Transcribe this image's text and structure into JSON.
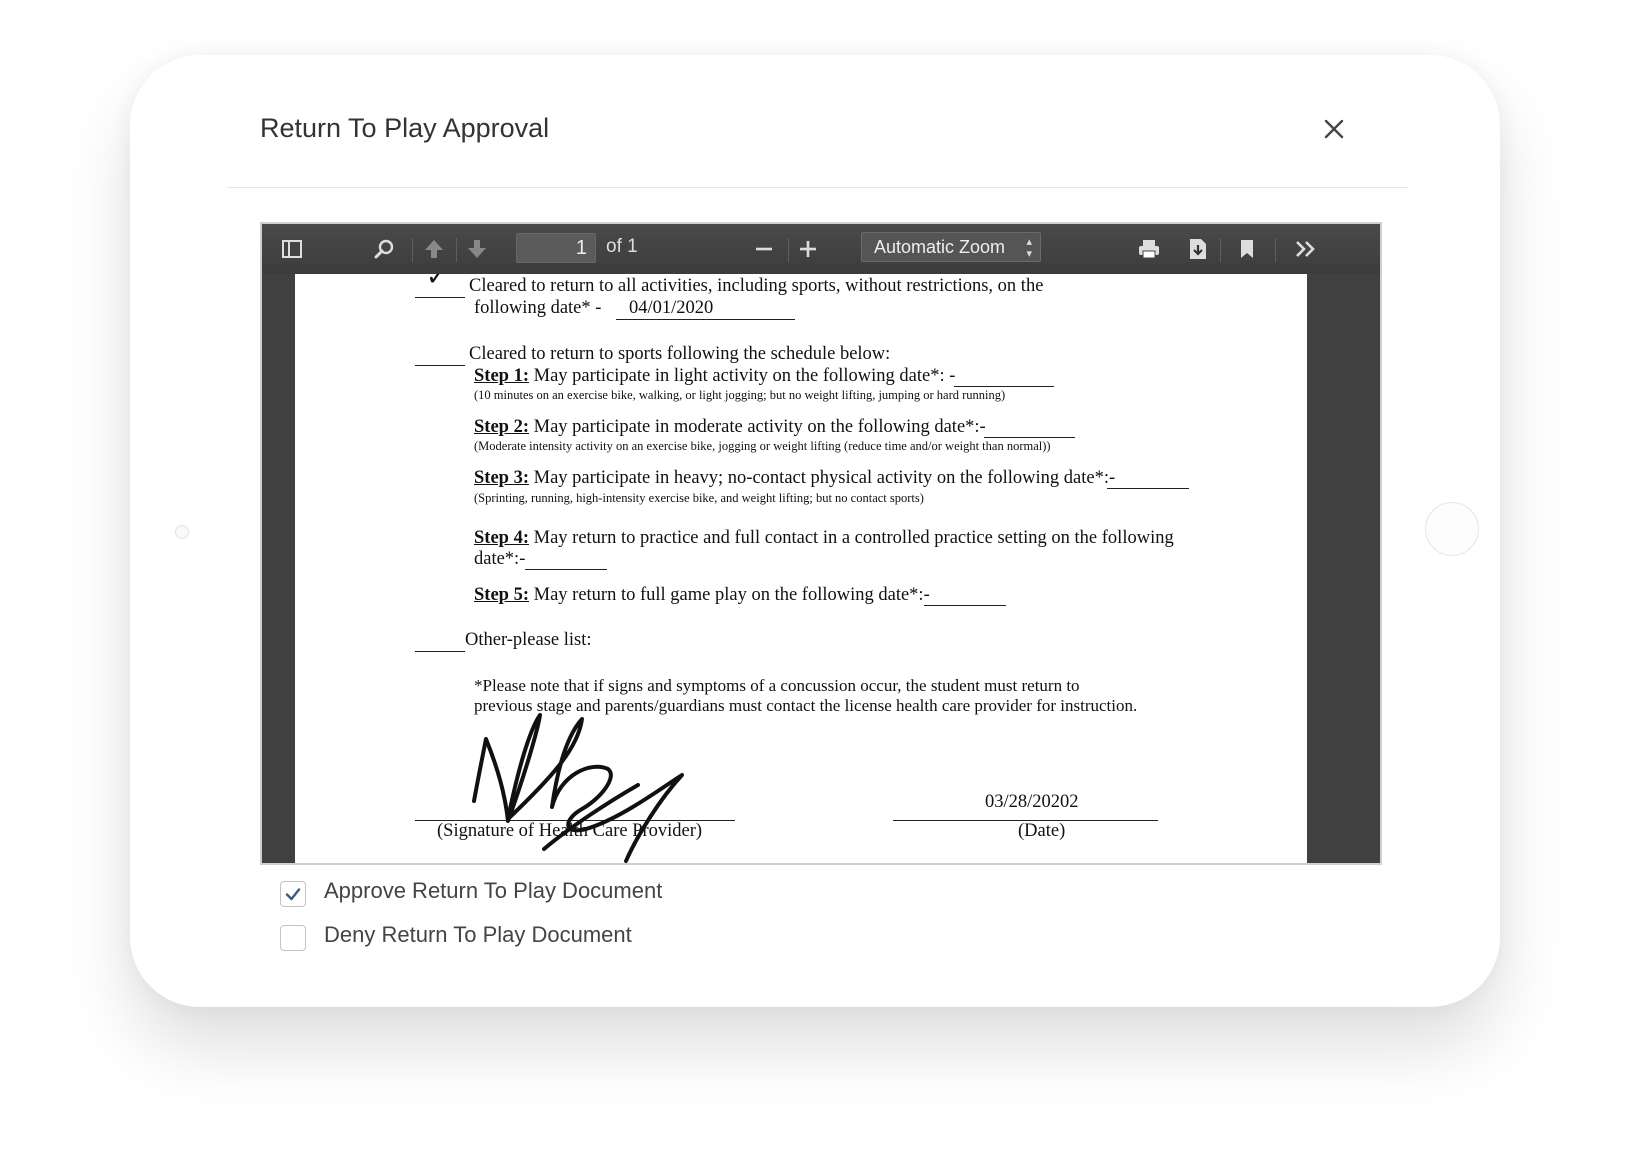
{
  "modal": {
    "title": "Return To Play Approval",
    "close_icon": "close-icon"
  },
  "pdf_toolbar": {
    "icons": [
      "sidebar-toggle-icon",
      "search-icon",
      "previous-page-icon",
      "next-page-icon",
      "zoom-out-icon",
      "zoom-in-icon",
      "print-icon",
      "download-icon",
      "bookmark-icon",
      "tools-menu-icon"
    ],
    "page_number": "1",
    "page_count_label": "of 1",
    "zoom_label": "Automatic Zoom"
  },
  "document": {
    "option1_checkmark": "✓",
    "option1_line1": "Cleared to return to all activities, including sports, without restrictions, on the",
    "option1_line2": "following date* -",
    "option1_date": "04/01/2020",
    "option2_line": "Cleared to return to sports following the schedule below:",
    "steps": [
      {
        "label": "Step 1:",
        "text": " May participate in light activity on the following date*: -",
        "note": "(10 minutes on an exercise bike, walking, or light jogging; but no weight lifting, jumping or hard running)"
      },
      {
        "label": "Step 2:",
        "text": " May participate in moderate activity on the following date*:-",
        "note": "(Moderate intensity activity on an exercise bike, jogging or weight lifting (reduce time and/or weight than normal))"
      },
      {
        "label": "Step 3:",
        "text": " May participate in heavy; no-contact physical activity on the following date*:-",
        "note": "(Sprinting, running, high-intensity exercise bike, and weight lifting; but no contact sports)"
      },
      {
        "label": "Step 4:",
        "text": " May return to practice and full contact in a controlled practice setting on the following",
        "text2": "date*:-"
      },
      {
        "label": "Step 5:",
        "text": " May return to full game play on the following date*:-"
      }
    ],
    "other_label": "Other-please list:",
    "note_line1": "*Please note that if  signs and symptoms of a concussion occur, the student must return to",
    "note_line2": "previous stage and parents/guardians must contact the license health care provider for instruction.",
    "signature_date": "03/28/20202",
    "signature_label": "(Signature of Health Care Provider)",
    "date_label": "(Date)"
  },
  "options": [
    {
      "label": "Approve Return To Play Document",
      "checked": true
    },
    {
      "label": "Deny Return To Play Document",
      "checked": false
    }
  ],
  "colors": {
    "checkbox_check": "#3d5a80",
    "toolbar_bg": "#3c3c3c"
  }
}
